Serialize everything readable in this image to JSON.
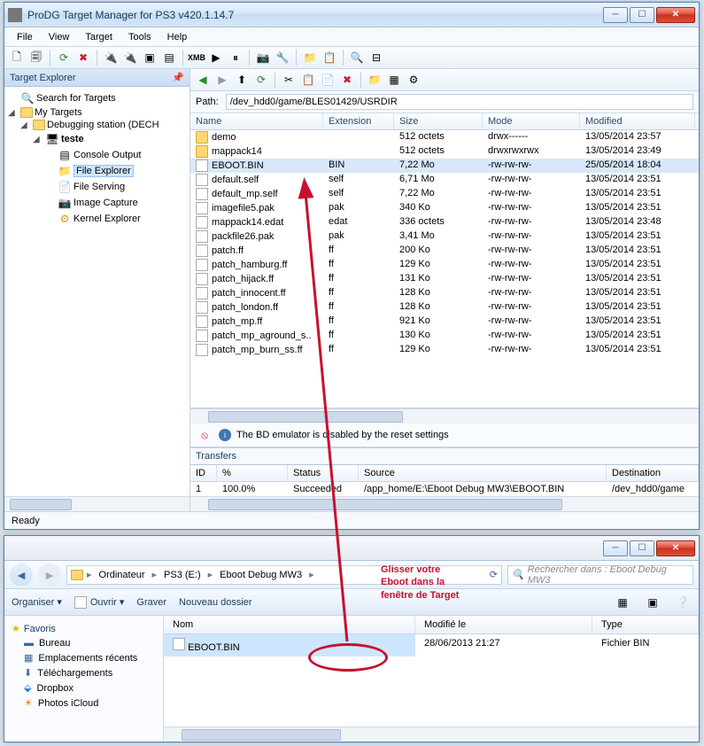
{
  "prodg": {
    "title": "ProDG Target Manager for PS3 v420.1.14.7",
    "menus": [
      "File",
      "View",
      "Target",
      "Tools",
      "Help"
    ],
    "explorer_title": "Target Explorer",
    "tree": {
      "search": "Search for Targets",
      "my_targets": "My Targets",
      "station": "Debugging station (DECH",
      "teste": "teste",
      "console_output": "Console Output",
      "file_explorer": "File Explorer",
      "file_serving": "File Serving",
      "image_capture": "Image Capture",
      "kernel_explorer": "Kernel Explorer"
    },
    "path_label": "Path:",
    "path_value": "/dev_hdd0/game/BLES01429/USRDIR",
    "cols": {
      "name": "Name",
      "ext": "Extension",
      "size": "Size",
      "mode": "Mode",
      "modified": "Modified"
    },
    "files": [
      {
        "name": "demo",
        "ext": "",
        "size": "512 octets",
        "mode": "drwx------",
        "modified": "13/05/2014 23:57",
        "folder": true
      },
      {
        "name": "mappack14",
        "ext": "",
        "size": "512 octets",
        "mode": "drwxrwxrwx",
        "modified": "13/05/2014 23:49",
        "folder": true
      },
      {
        "name": "EBOOT.BIN",
        "ext": "BIN",
        "size": "7,22 Mo",
        "mode": "-rw-rw-rw-",
        "modified": "25/05/2014 18:04",
        "selected": true
      },
      {
        "name": "default.self",
        "ext": "self",
        "size": "6,71 Mo",
        "mode": "-rw-rw-rw-",
        "modified": "13/05/2014 23:51"
      },
      {
        "name": "default_mp.self",
        "ext": "self",
        "size": "7,22 Mo",
        "mode": "-rw-rw-rw-",
        "modified": "13/05/2014 23:51"
      },
      {
        "name": "imagefile5.pak",
        "ext": "pak",
        "size": "340 Ko",
        "mode": "-rw-rw-rw-",
        "modified": "13/05/2014 23:51"
      },
      {
        "name": "mappack14.edat",
        "ext": "edat",
        "size": "336 octets",
        "mode": "-rw-rw-rw-",
        "modified": "13/05/2014 23:48"
      },
      {
        "name": "packfile26.pak",
        "ext": "pak",
        "size": "3,41 Mo",
        "mode": "-rw-rw-rw-",
        "modified": "13/05/2014 23:51"
      },
      {
        "name": "patch.ff",
        "ext": "ff",
        "size": "200 Ko",
        "mode": "-rw-rw-rw-",
        "modified": "13/05/2014 23:51"
      },
      {
        "name": "patch_hamburg.ff",
        "ext": "ff",
        "size": "129 Ko",
        "mode": "-rw-rw-rw-",
        "modified": "13/05/2014 23:51"
      },
      {
        "name": "patch_hijack.ff",
        "ext": "ff",
        "size": "131 Ko",
        "mode": "-rw-rw-rw-",
        "modified": "13/05/2014 23:51"
      },
      {
        "name": "patch_innocent.ff",
        "ext": "ff",
        "size": "128 Ko",
        "mode": "-rw-rw-rw-",
        "modified": "13/05/2014 23:51"
      },
      {
        "name": "patch_london.ff",
        "ext": "ff",
        "size": "128 Ko",
        "mode": "-rw-rw-rw-",
        "modified": "13/05/2014 23:51"
      },
      {
        "name": "patch_mp.ff",
        "ext": "ff",
        "size": "921 Ko",
        "mode": "-rw-rw-rw-",
        "modified": "13/05/2014 23:51"
      },
      {
        "name": "patch_mp_aground_s..",
        "ext": "ff",
        "size": "130 Ko",
        "mode": "-rw-rw-rw-",
        "modified": "13/05/2014 23:51"
      },
      {
        "name": "patch_mp_burn_ss.ff",
        "ext": "ff",
        "size": "129 Ko",
        "mode": "-rw-rw-rw-",
        "modified": "13/05/2014 23:51"
      }
    ],
    "bd_info": "The BD emulator is disabled by the reset settings",
    "transfers_title": "Transfers",
    "tr_cols": {
      "id": "ID",
      "pct": "%",
      "status": "Status",
      "source": "Source",
      "dest": "Destination"
    },
    "tr_row": {
      "id": "1",
      "pct": "100.0%",
      "status": "Succeeded",
      "source": "/app_home/E:\\Eboot Debug MW3\\EBOOT.BIN",
      "dest": "/dev_hdd0/game"
    },
    "status": "Ready"
  },
  "explorer": {
    "nav_back": "◄",
    "nav_fwd": "►",
    "crumbs": [
      "Ordinateur",
      "PS3 (E:)",
      "Eboot Debug MW3"
    ],
    "search_placeholder": "Rechercher dans : Eboot Debug MW3",
    "cmd_organize": "Organiser ▾",
    "cmd_open": "Ouvrir ▾",
    "cmd_burn": "Graver",
    "cmd_newfolder": "Nouveau dossier",
    "fav_title": "Favoris",
    "favs": [
      "Bureau",
      "Emplacements récents",
      "Téléchargements",
      "Dropbox",
      "Photos iCloud"
    ],
    "cols": {
      "name": "Nom",
      "modified": "Modifié le",
      "type": "Type"
    },
    "row": {
      "name": "EBOOT.BIN",
      "modified": "28/06/2013 21:27",
      "type": "Fichier BIN"
    }
  },
  "annotation": {
    "line1": "Glisser votre",
    "line2": "Eboot dans la",
    "line3": "fenêtre de Target"
  }
}
